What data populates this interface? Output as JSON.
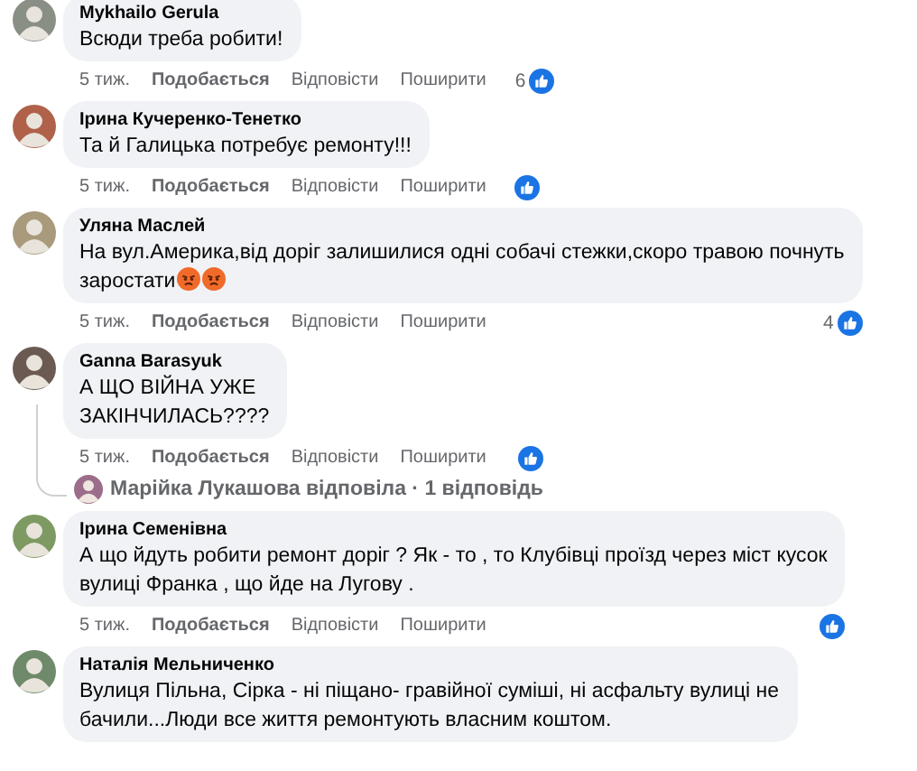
{
  "comments": [
    {
      "author": "Mykhailo Gerula",
      "lines": [
        "Всюди треба робити!"
      ],
      "actions": {
        "time": "5 тиж.",
        "like": "Подобається",
        "reply": "Відповісти",
        "share": "Поширити"
      },
      "reaction": {
        "kind": "like",
        "count": "6"
      }
    },
    {
      "author": "Ірина Кучеренко-Тенетко",
      "lines": [
        "Та й Галицька потребує ремонту!!!"
      ],
      "actions": {
        "time": "5 тиж.",
        "like": "Подобається",
        "reply": "Відповісти",
        "share": "Поширити"
      },
      "reaction": {
        "kind": "like"
      }
    },
    {
      "author": "Уляна Маслей",
      "lines": [
        "На вул.Америка,від доріг залишилися одні собачі стежки,скоро травою почнуть",
        "заростати"
      ],
      "emojis": [
        {
          "kind": "angry"
        },
        {
          "kind": "angry"
        }
      ],
      "actions": {
        "time": "5 тиж.",
        "like": "Подобається",
        "reply": "Відповісти",
        "share": "Поширити"
      },
      "reaction": {
        "kind": "like",
        "count": "4"
      }
    },
    {
      "author": "Ganna Barasyuk",
      "lines": [
        "А ЩО ВІЙНА УЖЕ",
        "ЗАКІНЧИЛАСЬ????"
      ],
      "actions": {
        "time": "5 тиж.",
        "like": "Подобається",
        "reply": "Відповісти",
        "share": "Поширити"
      },
      "reaction": {
        "kind": "like"
      },
      "replies_summary": "Марійка Лукашова відповіла · 1 відповідь"
    },
    {
      "author": "Ірина Семенівна",
      "lines": [
        "А що йдуть робити ремонт доріг ? Як - то , то Клубівці проїзд через міст кусок",
        "вулиці Франка , що йде на Лугову ."
      ],
      "actions": {
        "time": "5 тиж.",
        "like": "Подобається",
        "reply": "Відповісти",
        "share": "Поширити"
      },
      "reaction": {
        "kind": "like"
      }
    },
    {
      "author": "Наталія Мельниченко",
      "lines": [
        "Вулиця Пільна, Сірка - ні піщано- гравійної суміші, ні асфальту вулиці не",
        "бачили...Люди все життя ремонтують власним коштом."
      ]
    }
  ]
}
